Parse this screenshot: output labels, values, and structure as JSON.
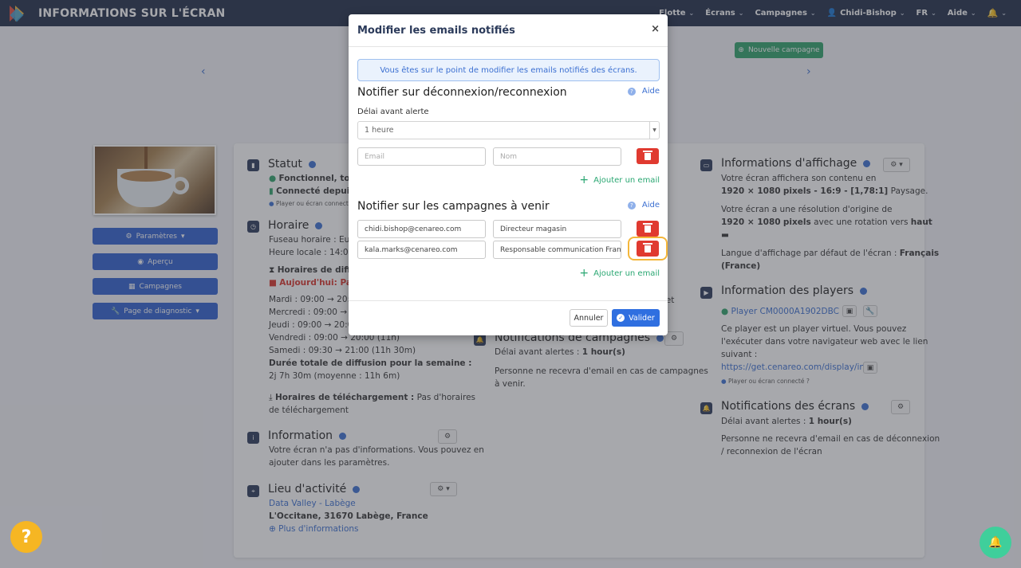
{
  "app": {
    "title": "INFORMATIONS SUR L'ÉCRAN"
  },
  "nav": {
    "items": [
      {
        "label": "Flotte"
      },
      {
        "label": "Écrans"
      },
      {
        "label": "Campagnes"
      },
      {
        "label": "Chidi-Bishop"
      },
      {
        "label": "FR"
      },
      {
        "label": "Aide"
      }
    ]
  },
  "background": {
    "new_campaign": "Nouvelle campagne",
    "side_buttons": [
      {
        "label": "Paramètres"
      },
      {
        "label": "Aperçu"
      },
      {
        "label": "Campagnes"
      },
      {
        "label": "Page de diagnostic"
      }
    ],
    "statut": {
      "title": "Statut",
      "line1": "Fonctionnel, tout",
      "line2": "Connecté depuis",
      "line3": "Player ou écran connect"
    },
    "horaire": {
      "title": "Horaire",
      "tz": "Fuseau horaire : Europ",
      "local": "Heure locale : 14:01:",
      "diff_title": "Horaires de diffus",
      "today": "Aujourd'hui: Pas d",
      "days": [
        "Mardi : 09:00 → 20:0",
        "Mercredi : 09:00 → 2",
        "Jeudi : 09:00 → 20:0",
        "Vendredi : 09:00 → 20:00 (11h)",
        "Samedi : 09:30 → 21:00 (11h 30m)"
      ],
      "total_label": "Durée totale de diffusion pour la semaine :",
      "total_value": "2j 7h 30m (moyenne : 11h 6m)",
      "dl_label": "Horaires de téléchargement :",
      "dl_value1": "Pas d'horaires",
      "dl_value2": "de téléchargement"
    },
    "information": {
      "title": "Information",
      "line1": "Votre écran n'a pas d'informations. Vous pouvez en",
      "line2": "ajouter dans les paramètres."
    },
    "lieu": {
      "title": "Lieu d'activité",
      "place": "Data Valley - Labège",
      "address": "L'Occitane, 31670 Labège, France",
      "more": "Plus d'informations"
    },
    "notif_campagnes": {
      "title": "Notifications de campagnes",
      "delay_label": "Délai avant alertes :",
      "delay_value": "1 hour(s)",
      "line1": "Personne ne recevra d'email en cas de campagnes",
      "line2": "à venir."
    },
    "cet_fragment": "cet",
    "affichage": {
      "title": "Informations d'affichage",
      "l1": "Votre écran affichera son contenu en",
      "l2a": "1920 × 1080",
      "l2b": "pixels - 16:9 - [1,78:1]",
      "l2c": "Paysage.",
      "l3": "Votre écran a une résolution d'origine de",
      "l4a": "1920 × 1080",
      "l4b": "pixels",
      "l4c": "avec une rotation vers",
      "l4d": "haut",
      "l5": "Langue d'affichage par défaut de l'écran :",
      "l5b": "Français",
      "l6": "(France)"
    },
    "players": {
      "title": "Information des players",
      "player": "Player CM0000A1902DBC",
      "l1": "Ce player est un player virtuel. Vous pouvez",
      "l2": "l'exécuter dans votre navigateur web avec le lien",
      "l3": "suivant :",
      "link": "https://get.cenareo.com/display/in...",
      "small": "Player ou écran connecté ?"
    },
    "notif_ecrans": {
      "title": "Notifications des écrans",
      "delay_label": "Délai avant alertes :",
      "delay_value": "1 hour(s)",
      "line1": "Personne ne recevra d'email en cas de déconnexion",
      "line2": "/ reconnexion de l'écran"
    }
  },
  "modal": {
    "title": "Modifier les emails notifiés",
    "close": "×",
    "alert": "Vous êtes sur le point de modifier les emails notifiés des écrans.",
    "section1": {
      "title": "Notifier sur déconnexion/reconnexion",
      "help": "Aide",
      "delay_label": "Délai avant alerte",
      "delay_value": "1 heure",
      "email_placeholder": "Email",
      "name_placeholder": "Nom",
      "add": "Ajouter un email"
    },
    "section2": {
      "title": "Notifier sur les campagnes à venir",
      "help": "Aide",
      "rows": [
        {
          "email": "chidi.bishop@cenareo.com",
          "name": "Directeur magasin"
        },
        {
          "email": "kala.marks@cenareo.com",
          "name": "Responsable communication France"
        }
      ],
      "add": "Ajouter un email"
    },
    "cancel": "Annuler",
    "submit": "Valider"
  },
  "colors": {
    "topbar": "#1f2d48",
    "primary": "#2f6fe0",
    "danger": "#e03a30",
    "success": "#2aa772",
    "highlight": "#f4b63a"
  }
}
